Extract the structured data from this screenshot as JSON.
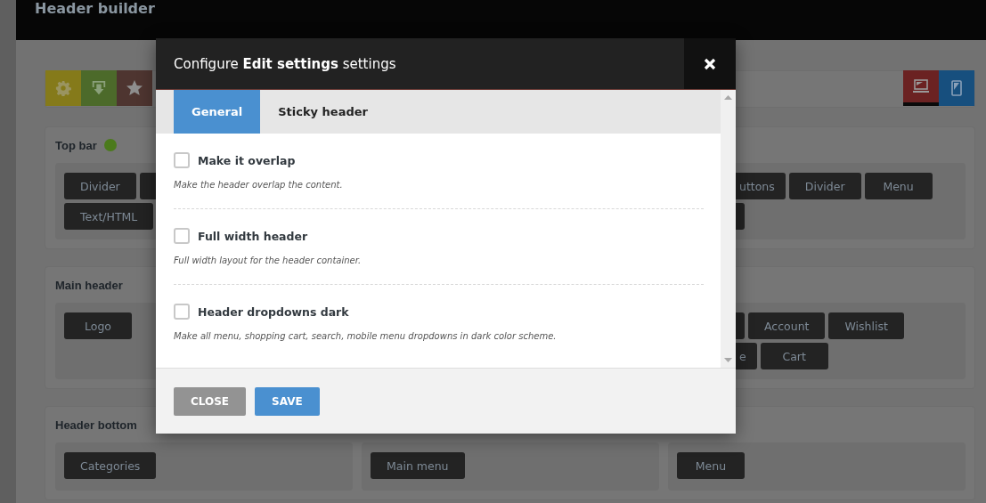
{
  "page": {
    "title": "Header builder"
  },
  "toolbar": {
    "tools": [
      {
        "kind": "settings"
      },
      {
        "kind": "import"
      },
      {
        "kind": "favorites"
      }
    ],
    "devices": [
      {
        "kind": "desktop",
        "selected": true
      },
      {
        "kind": "mobile",
        "selected": false
      }
    ]
  },
  "sections": [
    {
      "title": "Top bar",
      "enabled": true,
      "zones": {
        "left": [
          [
            {
              "kind": "full",
              "label": "Divider"
            },
            {
              "kind": "covered"
            }
          ],
          [
            {
              "kind": "full",
              "label": "Text/HTML"
            }
          ]
        ],
        "right": [
          [
            {
              "kind": "partial",
              "label": "uttons"
            },
            {
              "kind": "full",
              "label": "Divider"
            },
            {
              "kind": "full",
              "label": "Menu"
            }
          ],
          [
            {
              "kind": "covered"
            }
          ]
        ]
      }
    },
    {
      "title": "Main header",
      "enabled": false,
      "zones": {
        "left": [
          [
            {
              "kind": "full",
              "label": "Logo"
            }
          ]
        ],
        "right": [
          [
            {
              "kind": "covered"
            },
            {
              "kind": "full",
              "label": "Account"
            },
            {
              "kind": "full",
              "label": "Wishlist"
            }
          ],
          [
            {
              "kind": "partial",
              "label": "e"
            },
            {
              "kind": "full",
              "label": "Cart"
            }
          ]
        ]
      }
    },
    {
      "title": "Header bottom",
      "enabled": false,
      "zones": {
        "left": [
          [
            {
              "kind": "full",
              "label": "Categories"
            }
          ]
        ],
        "center": [
          [
            {
              "kind": "full",
              "label": "Main menu"
            }
          ]
        ],
        "right": [
          [
            {
              "kind": "full",
              "label": "Menu"
            }
          ]
        ]
      }
    }
  ],
  "modal": {
    "title": "Configure **Edit settings** settings",
    "tabs": [
      {
        "label": "General",
        "selected": true
      },
      {
        "label": "Sticky header",
        "selected": false
      }
    ],
    "options": [
      {
        "label": "Make it overlap",
        "checked": false,
        "description": "Make the header overlap the content."
      },
      {
        "label": "Full width header",
        "checked": false,
        "description": "Full width layout for the header container."
      },
      {
        "label": "Header dropdowns dark",
        "checked": false,
        "description": "Make all menu, shopping cart, search, mobile menu dropdowns in dark color scheme."
      }
    ],
    "buttons": [
      {
        "kind": "secondary",
        "label": "CLOSE"
      },
      {
        "kind": "primary",
        "label": "SAVE"
      }
    ]
  }
}
